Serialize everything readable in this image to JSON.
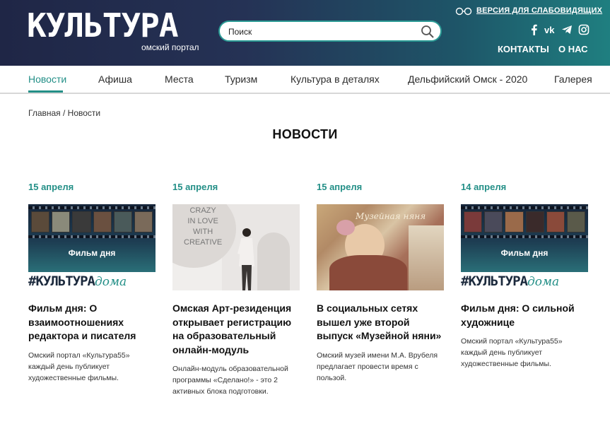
{
  "header": {
    "logo_main": "КУЛЬТУРА",
    "logo_sub": "омский портал",
    "search_placeholder": "Поиск",
    "accessibility_link": "ВЕРСИЯ ДЛЯ СЛАБОВИДЯЩИХ",
    "social": [
      "facebook-icon",
      "vk-icon",
      "telegram-icon",
      "instagram-icon"
    ],
    "links": [
      "КОНТАКТЫ",
      "О НАС"
    ]
  },
  "nav": {
    "items": [
      "Новости",
      "Афиша",
      "Места",
      "Туризм",
      "Культура в деталях",
      "Дельфийский Омск - 2020",
      "Галерея"
    ],
    "active": "Новости"
  },
  "breadcrumb": "Главная / Новости",
  "page_title": "НОВОСТИ",
  "cards": [
    {
      "date": "15 апреля",
      "image_kind": "film",
      "image_label": "Фильм дня",
      "image_tag_main": "#КУЛЬТУРА",
      "image_tag_accent": "дома",
      "title": "Фильм дня: О взаимоотношениях редактора и писателя",
      "text": "Омский портал «Культура55» каждый день публикует художественные фильмы."
    },
    {
      "date": "15 апреля",
      "image_kind": "art",
      "image_text": "CRAZY\nIN LOVE\nWITH\nCREATIVE",
      "title": "Омская Арт-резиденция открывает регистрацию на образовательный онлайн-модуль",
      "text": "Онлайн-модуль образовательной программы «Сделано!» - это 2 активных блока подготовки."
    },
    {
      "date": "15 апреля",
      "image_kind": "painting",
      "image_text": "Музейная няня",
      "title": "В социальных сетях вышел уже второй выпуск «Музейной няни»",
      "text": "Омский музей имени М.А. Врубеля предлагает провести время с пользой."
    },
    {
      "date": "14 апреля",
      "image_kind": "film",
      "image_label": "Фильм дня",
      "image_tag_main": "#КУЛЬТУРА",
      "image_tag_accent": "дома",
      "title": "Фильм дня: О сильной художнице",
      "text": "Омский портал «Культура55» каждый день публикует художественные фильмы."
    }
  ],
  "colors": {
    "accent": "#238f87",
    "header_dark": "#1f2646",
    "header_teal": "#1f7f80"
  }
}
